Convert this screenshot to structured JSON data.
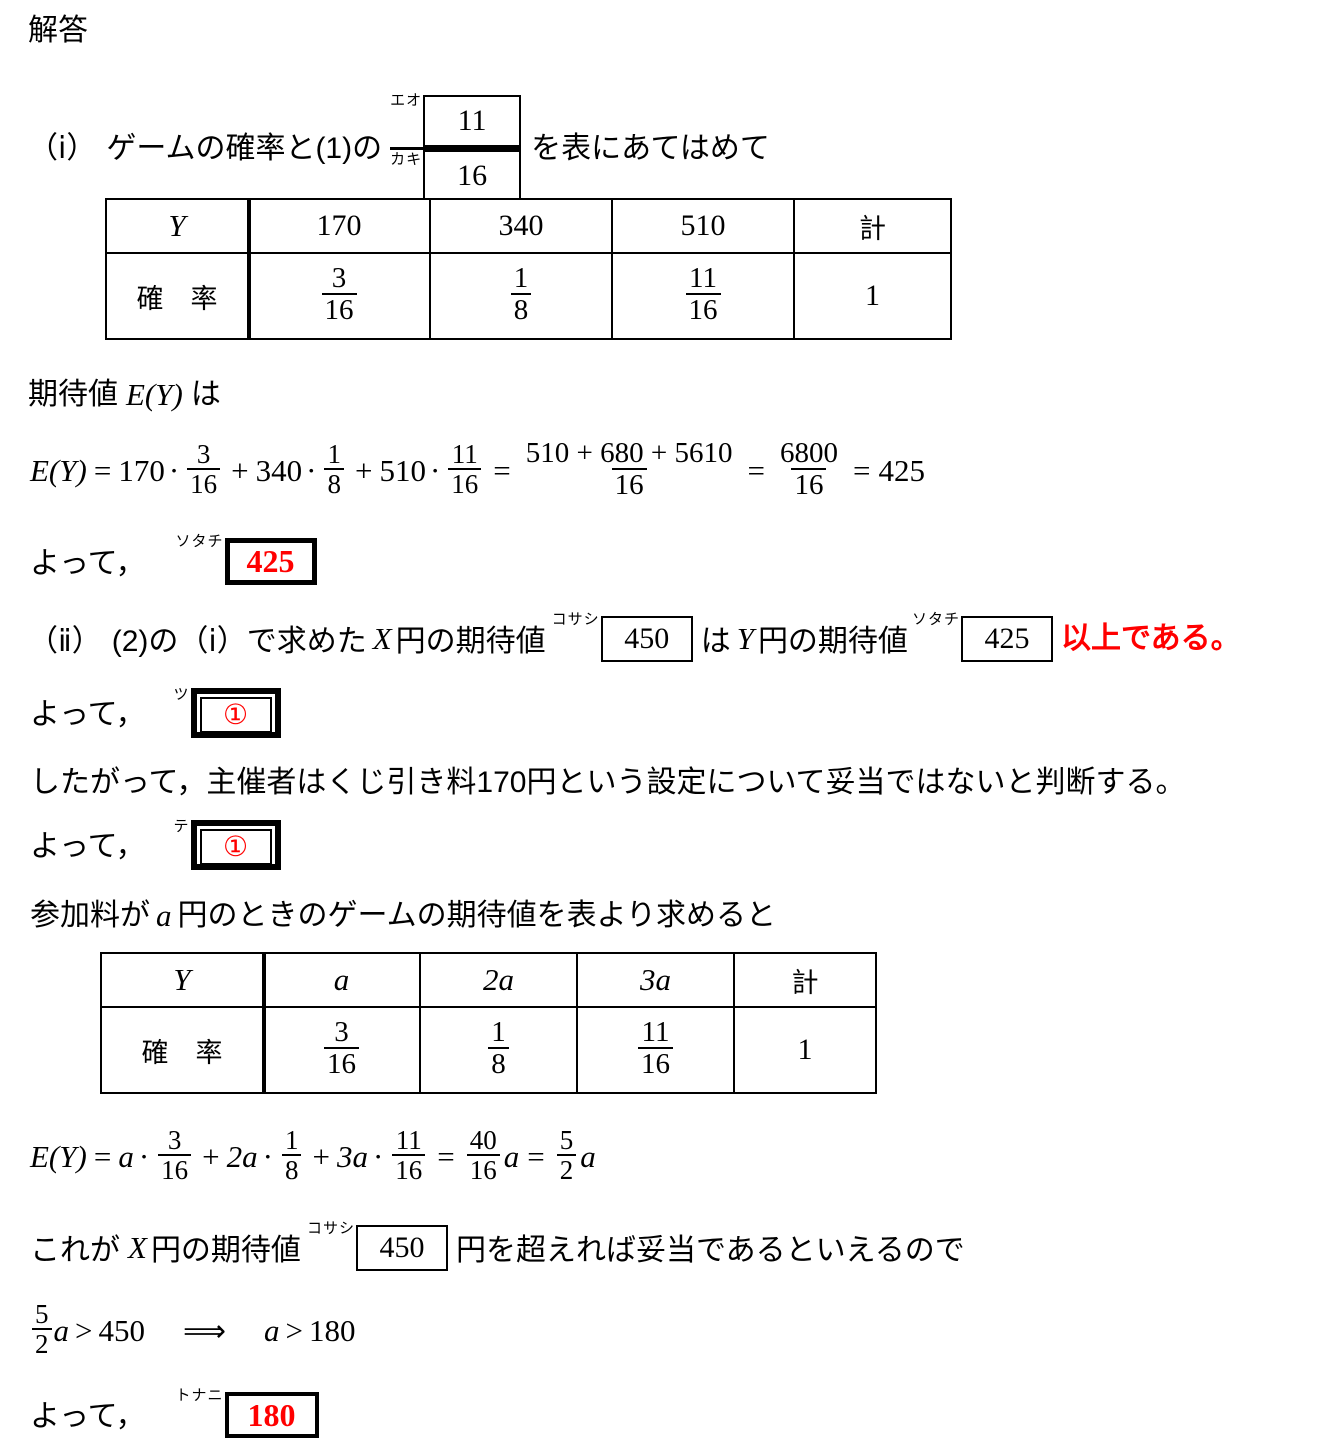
{
  "document": {
    "heading": "解答",
    "language": "ja"
  },
  "colors": {
    "answer_red": "#FF0000",
    "text_black": "#000000",
    "background": "#FFFFFF"
  },
  "sections": {
    "part_i": {
      "marker": "（ⅰ）",
      "text_before": "ゲームの確率と(1)の",
      "text_after": "を表にあてはめて",
      "fraction": {
        "numerator_label": "エオ",
        "numerator_value": "11",
        "denominator_label": "カキ",
        "denominator_value": "16"
      }
    },
    "table1": {
      "row_labels": [
        "Y",
        "確　率"
      ],
      "columns": [
        "170",
        "340",
        "510",
        "計"
      ],
      "probabilities": [
        {
          "num": "3",
          "den": "16"
        },
        {
          "num": "1",
          "den": "8"
        },
        {
          "num": "11",
          "den": "16"
        }
      ],
      "total": "1"
    },
    "expectation_intro": {
      "prefix": "期待値",
      "symbol": "E(Y)",
      "suffix": "は"
    },
    "equation1": {
      "lhs": "E(Y)",
      "eq1": "=",
      "terms": [
        {
          "coef": "170",
          "dot": "·",
          "num": "3",
          "den": "16"
        },
        {
          "coef": "340",
          "dot": "·",
          "num": "1",
          "den": "8"
        },
        {
          "coef": "510",
          "dot": "·",
          "num": "11",
          "den": "16"
        }
      ],
      "plus": "+",
      "step2": {
        "num": "510 + 680 + 5610",
        "den": "16"
      },
      "step3": {
        "num": "6800",
        "den": "16"
      },
      "result": "425"
    },
    "conclusion1": {
      "prefix": "よって，",
      "box": {
        "label": "ソタチ",
        "value": "425",
        "style": "thick-red"
      }
    },
    "part_ii": {
      "marker": "（ⅱ）",
      "text1": "(2)の（ⅰ）で求めた",
      "var_x": "X",
      "text2": "円の期待値",
      "box_x": {
        "label": "コサシ",
        "value": "450",
        "style": "thin-black"
      },
      "text3": "は",
      "var_y": "Y",
      "text4": "円の期待値",
      "box_y": {
        "label": "ソタチ",
        "value": "425",
        "style": "thin-black"
      },
      "text5": "以上である。"
    },
    "conclusion2": {
      "prefix": "よって，",
      "box": {
        "label": "ツ",
        "value": "①",
        "style": "double-red"
      }
    },
    "statement": "したがって，主催者はくじ引き料170円という設定について妥当ではないと判断する。",
    "conclusion3": {
      "prefix": "よって，",
      "box": {
        "label": "テ",
        "value": "①",
        "style": "double-red"
      }
    },
    "part_a_intro": {
      "text1": "参加料が",
      "var_a": "a",
      "text2": "円のときのゲームの期待値を表より求めると"
    },
    "table2": {
      "row_labels": [
        "Y",
        "確　率"
      ],
      "columns": [
        "a",
        "2a",
        "3a",
        "計"
      ],
      "probabilities": [
        {
          "num": "3",
          "den": "16"
        },
        {
          "num": "1",
          "den": "8"
        },
        {
          "num": "11",
          "den": "16"
        }
      ],
      "total": "1"
    },
    "equation2": {
      "lhs": "E(Y)",
      "terms": [
        {
          "coef": "a",
          "dot": "·",
          "num": "3",
          "den": "16"
        },
        {
          "coef": "2a",
          "dot": "·",
          "num": "1",
          "den": "8"
        },
        {
          "coef": "3a",
          "dot": "·",
          "num": "11",
          "den": "16"
        }
      ],
      "step2": {
        "num": "40",
        "den": "16",
        "suffix": "a"
      },
      "step3": {
        "num": "5",
        "den": "2",
        "suffix": "a"
      }
    },
    "compare_line": {
      "text1": "これが",
      "var_x": "X",
      "text2": "円の期待値",
      "box": {
        "label": "コサシ",
        "value": "450",
        "style": "thin-black"
      },
      "text3": "円を超えれば妥当であるといえるので"
    },
    "inequality": {
      "lhs_num": "5",
      "lhs_den": "2",
      "lhs_var": "a",
      "op1": ">",
      "rhs1": "450",
      "arrow": "⟹",
      "rhs_var": "a",
      "op2": ">",
      "rhs2": "180"
    },
    "conclusion4": {
      "prefix": "よって，",
      "box": {
        "label": "トナニ",
        "value": "180",
        "style": "thick-red"
      }
    }
  }
}
